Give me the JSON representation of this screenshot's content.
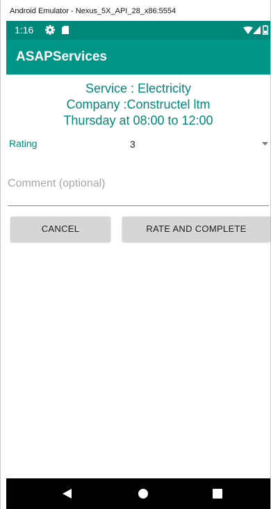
{
  "window": {
    "title": "Android Emulator - Nexus_5X_API_28_x86:5554"
  },
  "status_bar": {
    "time": "1:16",
    "icons": [
      "gear-icon",
      "sdcard-icon",
      "wifi-icon",
      "signal-icon",
      "battery-icon"
    ],
    "background": "#00897b"
  },
  "app_bar": {
    "title": "ASAPServices",
    "background": "#009688"
  },
  "booking": {
    "service": "Service : Electricity",
    "company": "Company :Constructel ltm",
    "schedule": "Thursday at 08:00 to 12:00",
    "text_color": "#00897b"
  },
  "rating": {
    "label": "Rating",
    "selected_value": "3",
    "icon": "dropdown-triangle-icon"
  },
  "comment": {
    "value": "",
    "placeholder": "Comment (optional)"
  },
  "actions": {
    "cancel_label": "CANCEL",
    "rate_label": "RATE AND COMPLETE"
  },
  "nav_bar": {
    "icons": [
      "back-icon",
      "home-icon",
      "recents-icon"
    ]
  }
}
